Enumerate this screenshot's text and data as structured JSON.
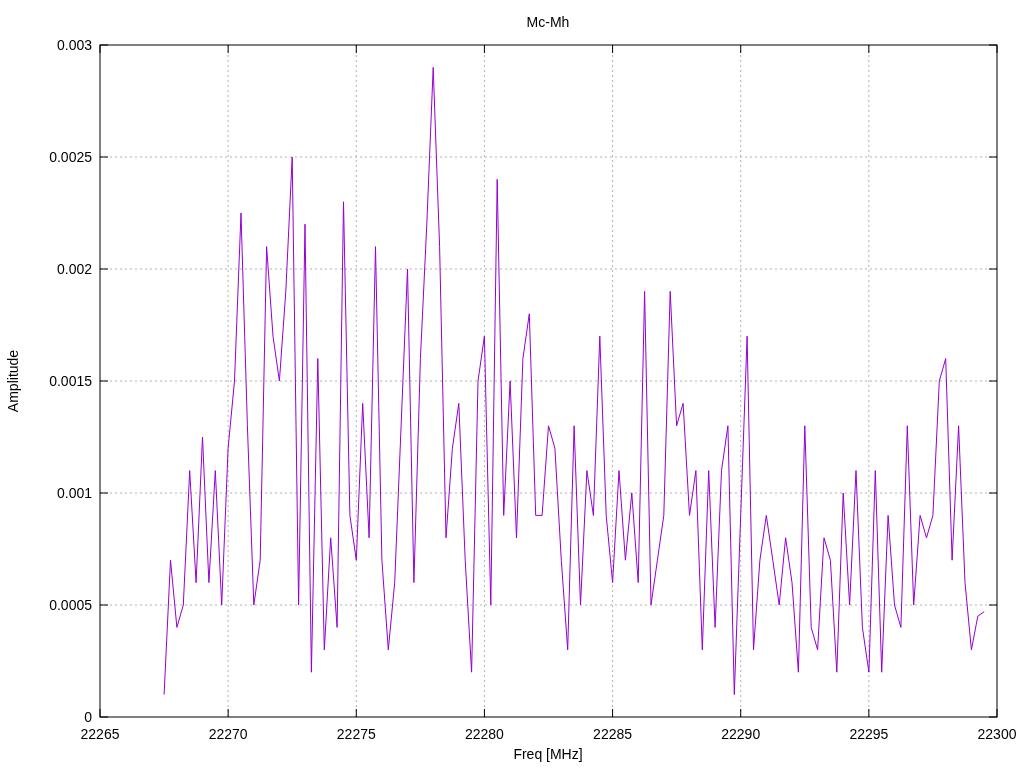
{
  "chart_data": {
    "type": "line",
    "title": "Mc-Mh",
    "xlabel": "Freq [MHz]",
    "ylabel": "Amplitude",
    "grid": true,
    "xlim": [
      22265,
      22300
    ],
    "ylim": [
      0,
      0.003
    ],
    "xticks": [
      22265,
      22270,
      22275,
      22280,
      22285,
      22290,
      22295,
      22300
    ],
    "yticks": [
      {
        "value": 0,
        "label": "0"
      },
      {
        "value": 0.0005,
        "label": "0.0005"
      },
      {
        "value": 0.001,
        "label": "0.001"
      },
      {
        "value": 0.0015,
        "label": "0.0015"
      },
      {
        "value": 0.002,
        "label": "0.002"
      },
      {
        "value": 0.0025,
        "label": "0.0025"
      },
      {
        "value": 0.003,
        "label": "0.003"
      }
    ],
    "x": [
      22267.5,
      22267.75,
      22268,
      22268.25,
      22268.5,
      22268.75,
      22269,
      22269.25,
      22269.5,
      22269.75,
      22270,
      22270.25,
      22270.5,
      22270.75,
      22271,
      22271.25,
      22271.5,
      22271.75,
      22272,
      22272.25,
      22272.5,
      22272.75,
      22273,
      22273.25,
      22273.5,
      22273.75,
      22274,
      22274.25,
      22274.5,
      22274.75,
      22275,
      22275.25,
      22275.5,
      22275.75,
      22276,
      22276.25,
      22276.5,
      22276.75,
      22277,
      22277.25,
      22277.5,
      22277.75,
      22278,
      22278.25,
      22278.5,
      22278.75,
      22279,
      22279.25,
      22279.5,
      22279.75,
      22280,
      22280.25,
      22280.5,
      22280.75,
      22281,
      22281.25,
      22281.5,
      22281.75,
      22282,
      22282.25,
      22282.5,
      22282.75,
      22283,
      22283.25,
      22283.5,
      22283.75,
      22284,
      22284.25,
      22284.5,
      22284.75,
      22285,
      22285.25,
      22285.5,
      22285.75,
      22286,
      22286.25,
      22286.5,
      22286.75,
      22287,
      22287.25,
      22287.5,
      22287.75,
      22288,
      22288.25,
      22288.5,
      22288.75,
      22289,
      22289.25,
      22289.5,
      22289.75,
      22290,
      22290.25,
      22290.5,
      22290.75,
      22291,
      22291.25,
      22291.5,
      22291.75,
      22292,
      22292.25,
      22292.5,
      22292.75,
      22293,
      22293.25,
      22293.5,
      22293.75,
      22294,
      22294.25,
      22294.5,
      22294.75,
      22295,
      22295.25,
      22295.5,
      22295.75,
      22296,
      22296.25,
      22296.5,
      22296.75,
      22297,
      22297.25,
      22297.5,
      22297.75,
      22298,
      22298.25,
      22298.5,
      22298.75,
      22299,
      22299.25,
      22299.5
    ],
    "series": [
      {
        "color": "#9400d3",
        "values": [
          0.0001,
          0.0007,
          0.0004,
          0.0005,
          0.0011,
          0.0006,
          0.00125,
          0.0006,
          0.0011,
          0.0005,
          0.0012,
          0.0015,
          0.00225,
          0.0013,
          0.0005,
          0.0007,
          0.0021,
          0.0017,
          0.0015,
          0.0019,
          0.0025,
          0.0005,
          0.0022,
          0.0002,
          0.0016,
          0.0003,
          0.0008,
          0.0004,
          0.0023,
          0.0009,
          0.0007,
          0.0014,
          0.0008,
          0.0021,
          0.0007,
          0.0003,
          0.0006,
          0.0013,
          0.002,
          0.0006,
          0.0016,
          0.0022,
          0.0029,
          0.0021,
          0.0008,
          0.0012,
          0.0014,
          0.0007,
          0.0002,
          0.0015,
          0.0017,
          0.0005,
          0.0024,
          0.0009,
          0.0015,
          0.0008,
          0.0016,
          0.0018,
          0.0009,
          0.0009,
          0.0013,
          0.0012,
          0.0007,
          0.0003,
          0.0013,
          0.0005,
          0.0011,
          0.0009,
          0.0017,
          0.0009,
          0.0006,
          0.0011,
          0.0007,
          0.001,
          0.0006,
          0.0019,
          0.0005,
          0.0007,
          0.0009,
          0.0019,
          0.0013,
          0.0014,
          0.0009,
          0.0011,
          0.0003,
          0.0011,
          0.0004,
          0.0011,
          0.0013,
          0.0001,
          0.0009,
          0.0017,
          0.0003,
          0.0007,
          0.0009,
          0.0007,
          0.0005,
          0.0008,
          0.0006,
          0.0002,
          0.0013,
          0.0004,
          0.0003,
          0.0008,
          0.0007,
          0.0002,
          0.001,
          0.0005,
          0.0011,
          0.0004,
          0.0002,
          0.0011,
          0.0002,
          0.0009,
          0.0005,
          0.0004,
          0.0013,
          0.0005,
          0.0009,
          0.0008,
          0.0009,
          0.0015,
          0.0016,
          0.0007,
          0.0013,
          0.0006,
          0.0003,
          0.00045,
          0.00047
        ]
      }
    ]
  }
}
